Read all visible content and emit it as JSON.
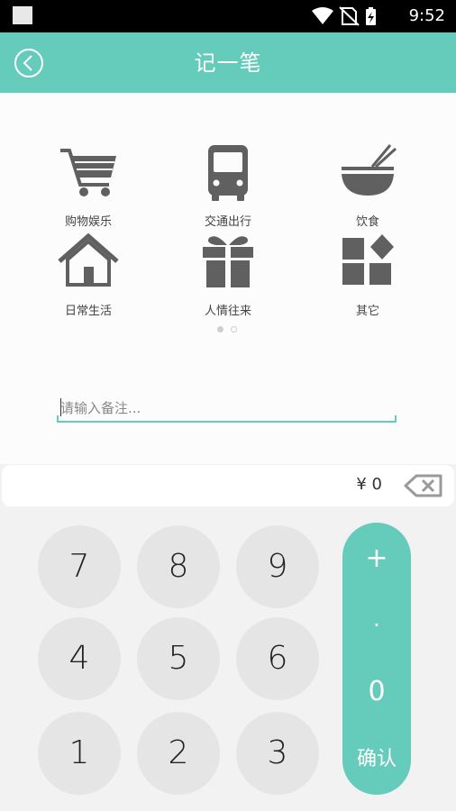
{
  "status_bar": {
    "time": "9:52"
  },
  "app_bar": {
    "title": "记一笔"
  },
  "categories": [
    {
      "label": "购物娱乐",
      "icon": "shopping-cart-icon"
    },
    {
      "label": "交通出行",
      "icon": "bus-icon"
    },
    {
      "label": "饮食",
      "icon": "food-bowl-icon"
    },
    {
      "label": "日常生活",
      "icon": "house-icon"
    },
    {
      "label": "人情往来",
      "icon": "gift-icon"
    },
    {
      "label": "其它",
      "icon": "other-grid-icon"
    }
  ],
  "pager": {
    "pages": 2,
    "active": 0
  },
  "note": {
    "placeholder": "请输入备注...",
    "value": ""
  },
  "amount": {
    "display": "¥ 0"
  },
  "keypad": {
    "keys": [
      "7",
      "8",
      "9",
      "4",
      "5",
      "6",
      "1",
      "2",
      "3"
    ],
    "plus": "+",
    "dot": ".",
    "zero": "0",
    "confirm": "确认"
  },
  "colors": {
    "accent": "#65cbbb",
    "icon": "#606060",
    "key_bg": "#e5e5e5",
    "background": "#f2f2f2"
  }
}
